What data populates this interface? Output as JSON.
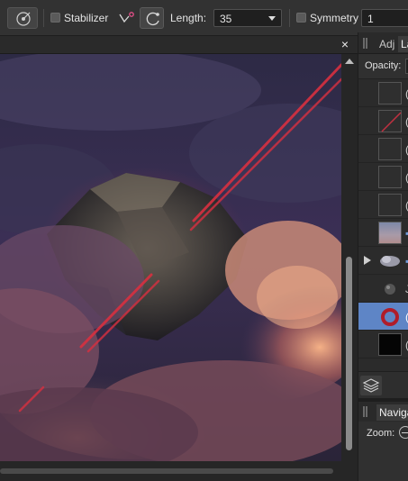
{
  "toolbar": {
    "stabilizer_label": "Stabilizer",
    "length_label": "Length:",
    "length_value": "35",
    "symmetry_label": "Symmetry",
    "symmetry_value": "1"
  },
  "doc_close": "×",
  "panels": {
    "tab_adjustments": "Adj",
    "tab_layers": "La",
    "opacity_label": "Opacity:",
    "navigator_tab": "Navigat",
    "zoom_label": "Zoom:"
  },
  "layers": [
    {
      "thumb": "dark",
      "selected": false,
      "expand": false
    },
    {
      "thumb": "red-streak",
      "selected": false,
      "expand": false
    },
    {
      "thumb": "dark",
      "selected": false,
      "expand": false
    },
    {
      "thumb": "dark",
      "selected": false,
      "expand": false
    },
    {
      "thumb": "dark",
      "selected": false,
      "expand": false
    },
    {
      "thumb": "photo",
      "selected": false,
      "expand": false
    },
    {
      "thumb": "cloud",
      "selected": false,
      "expand": true
    },
    {
      "thumb": "rock",
      "selected": false,
      "expand": false
    },
    {
      "thumb": "red-ring",
      "selected": true,
      "expand": false
    },
    {
      "thumb": "black",
      "selected": false,
      "expand": false
    }
  ],
  "colors": {
    "selection": "#5e85c6",
    "laser": "#d83040"
  }
}
